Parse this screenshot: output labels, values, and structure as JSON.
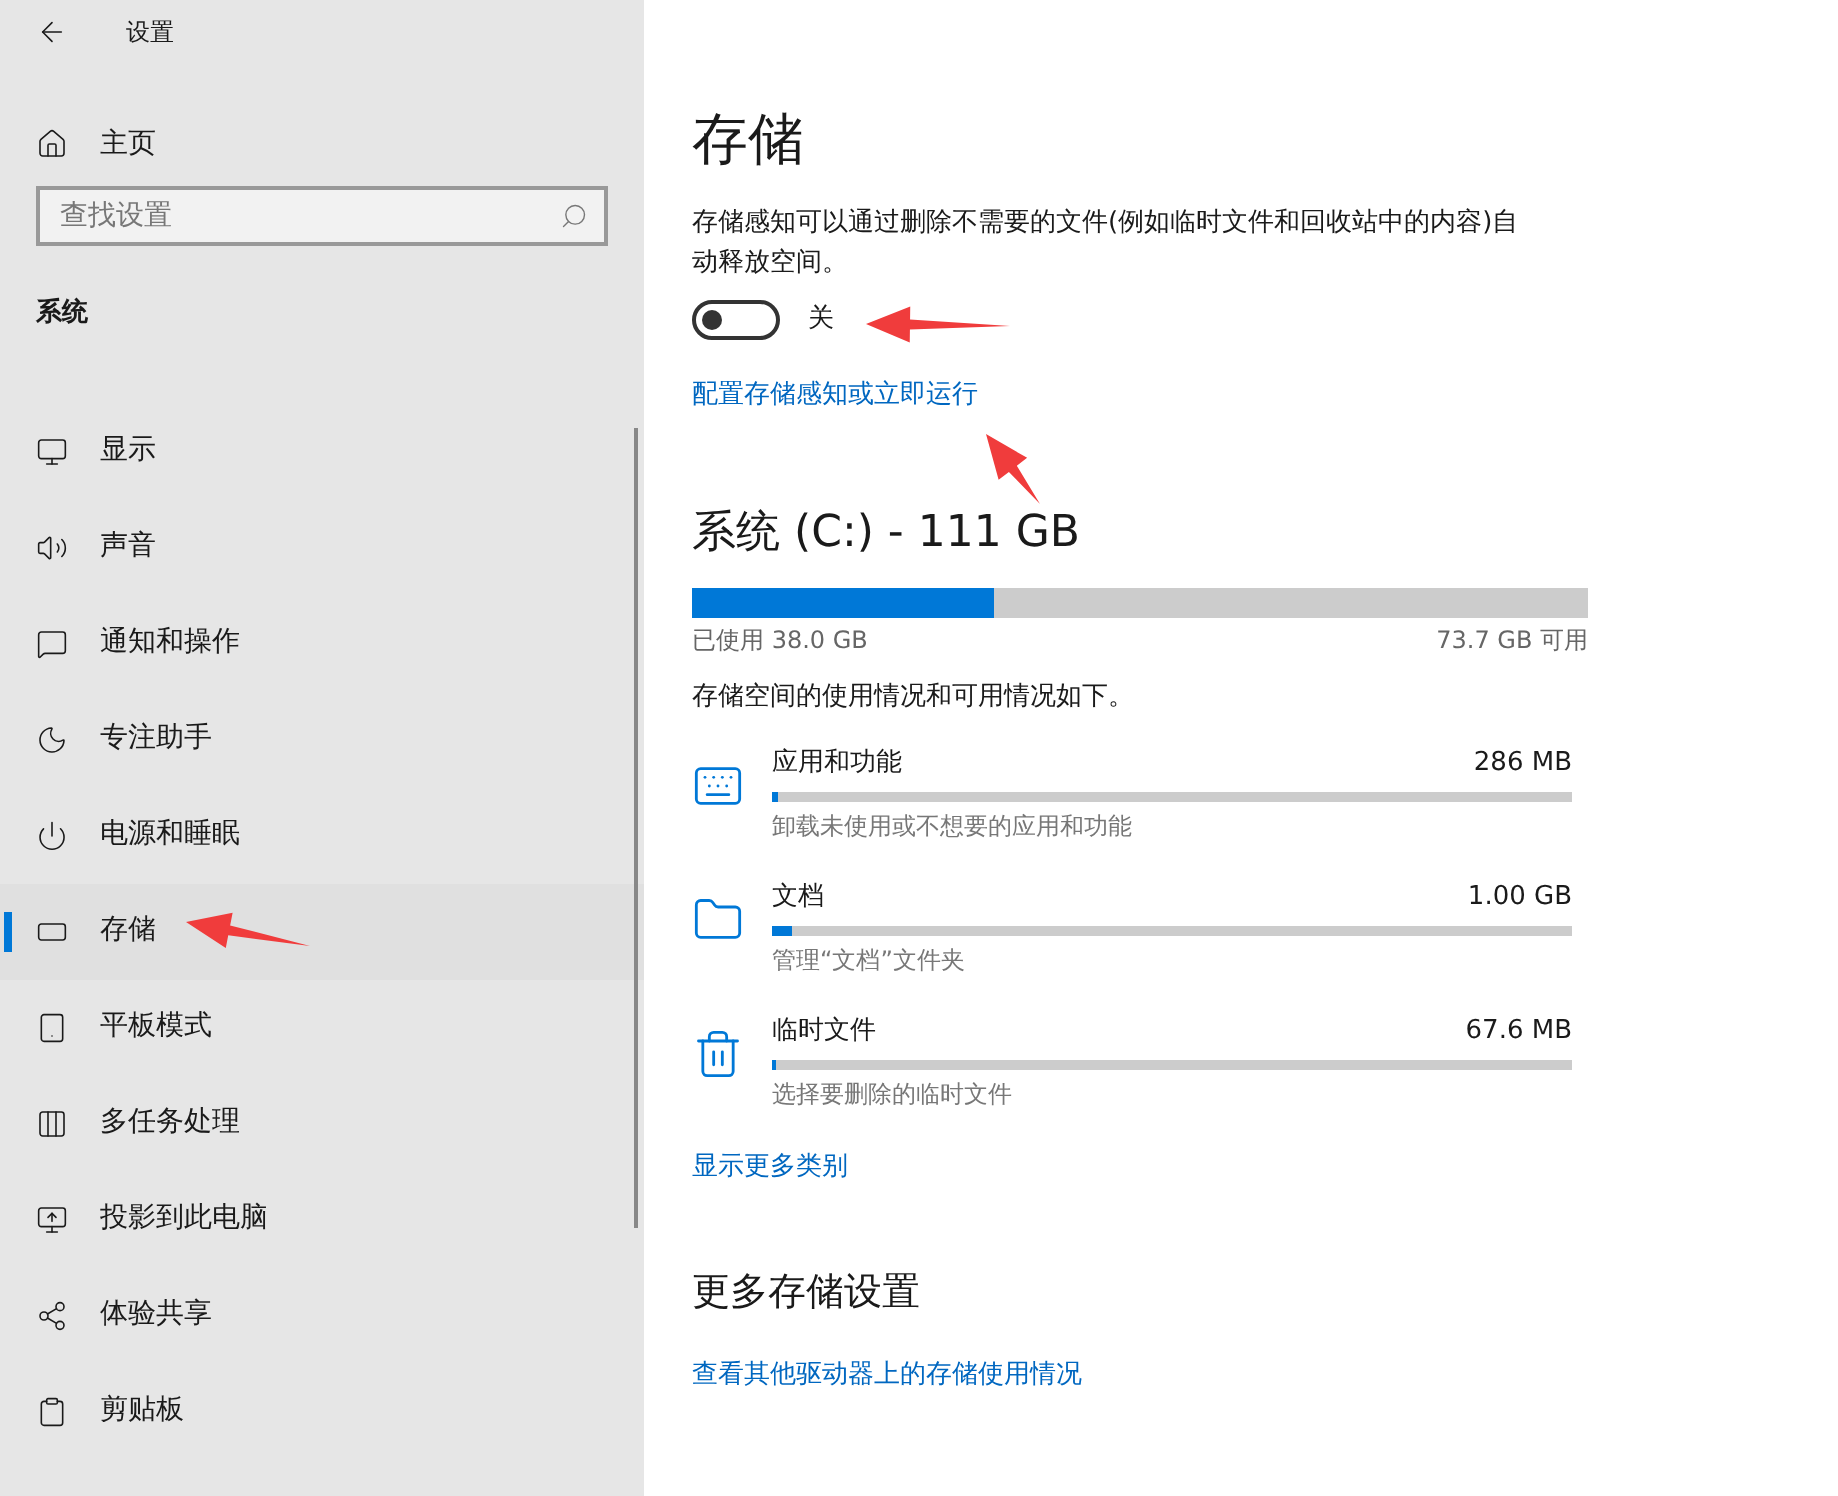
{
  "window": {
    "title": "设置"
  },
  "sidebar": {
    "home": "主页",
    "search": {
      "placeholder": "查找设置"
    },
    "section": "系统",
    "items": [
      {
        "label": "显示",
        "selected": false
      },
      {
        "label": "声音",
        "selected": false
      },
      {
        "label": "通知和操作",
        "selected": false
      },
      {
        "label": "专注助手",
        "selected": false
      },
      {
        "label": "电源和睡眠",
        "selected": false
      },
      {
        "label": "存储",
        "selected": true
      },
      {
        "label": "平板模式",
        "selected": false
      },
      {
        "label": "多任务处理",
        "selected": false
      },
      {
        "label": "投影到此电脑",
        "selected": false
      },
      {
        "label": "体验共享",
        "selected": false
      },
      {
        "label": "剪贴板",
        "selected": false
      }
    ]
  },
  "page": {
    "title": "存储",
    "description": "存储感知可以通过删除不需要的文件(例如临时文件和回收站中的内容)自动释放空间。",
    "storage_sense": {
      "on": false,
      "label": "关"
    },
    "configure_link": "配置存储感知或立即运行",
    "drive": {
      "title": "系统 (C:) - 111 GB",
      "level": 0.337,
      "used": "已使用 38.0 GB",
      "free": "73.7 GB 可用"
    },
    "usage_note": "存储空间的使用情况和可用情况如下。",
    "categories": [
      {
        "name": "应用和功能",
        "size": "286 MB",
        "level": 0.008,
        "hint": "卸载未使用或不想要的应用和功能"
      },
      {
        "name": "文档",
        "size": "1.00 GB",
        "level": 0.025,
        "hint": "管理“文档”文件夹"
      },
      {
        "name": "临时文件",
        "size": "67.6 MB",
        "level": 0.003,
        "hint": "选择要删除的临时文件"
      }
    ],
    "more_link": "显示更多类别",
    "more_settings": {
      "title": "更多存储设置",
      "links": [
        "查看其他驱动器上的存储使用情况"
      ]
    }
  }
}
